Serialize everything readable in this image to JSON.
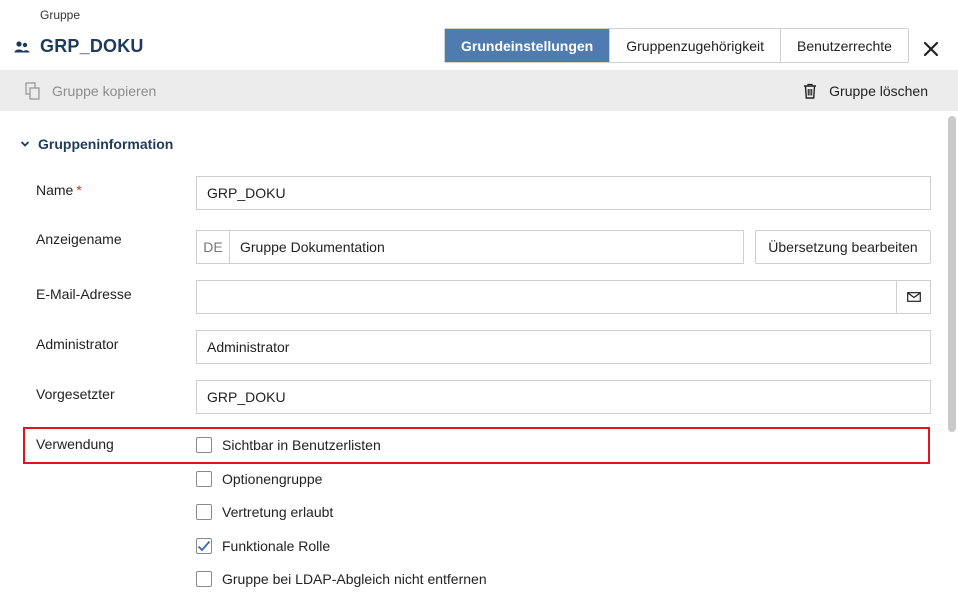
{
  "header": {
    "breadcrumb": "Gruppe",
    "title": "GRP_DOKU",
    "icon": "group-icon"
  },
  "tabs": [
    {
      "label": "Grundeinstellungen",
      "active": true
    },
    {
      "label": "Gruppenzugehörigkeit",
      "active": false
    },
    {
      "label": "Benutzerrechte",
      "active": false
    }
  ],
  "toolbar": {
    "copy_label": "Gruppe kopieren",
    "copy_icon": "copy-icon",
    "copy_disabled": true,
    "delete_label": "Gruppe löschen",
    "delete_icon": "trash-icon"
  },
  "section": {
    "title": "Gruppeninformation",
    "expanded": true
  },
  "fields": {
    "name": {
      "label": "Name",
      "required_mark": "*",
      "value": "GRP_DOKU"
    },
    "display_name": {
      "label": "Anzeigename",
      "lang": "DE",
      "value": "Gruppe Dokumentation",
      "button": "Übersetzung bearbeiten"
    },
    "email": {
      "label": "E-Mail-Adresse",
      "value": "",
      "icon": "mail-icon"
    },
    "administrator": {
      "label": "Administrator",
      "value": "Administrator"
    },
    "supervisor": {
      "label": "Vorgesetzter",
      "value": "GRP_DOKU"
    },
    "usage": {
      "label": "Verwendung",
      "options": [
        {
          "label": "Sichtbar in Benutzerlisten",
          "checked": false
        },
        {
          "label": "Optionengruppe",
          "checked": false
        },
        {
          "label": "Vertretung erlaubt",
          "checked": false
        },
        {
          "label": "Funktionale Rolle",
          "checked": true
        },
        {
          "label": "Gruppe bei LDAP-Abgleich nicht entfernen",
          "checked": false
        }
      ]
    }
  },
  "colors": {
    "accent": "#4f7bb0",
    "title": "#1f3b5b",
    "highlight": "#e0141e",
    "toolbar_bg": "#ececec"
  }
}
